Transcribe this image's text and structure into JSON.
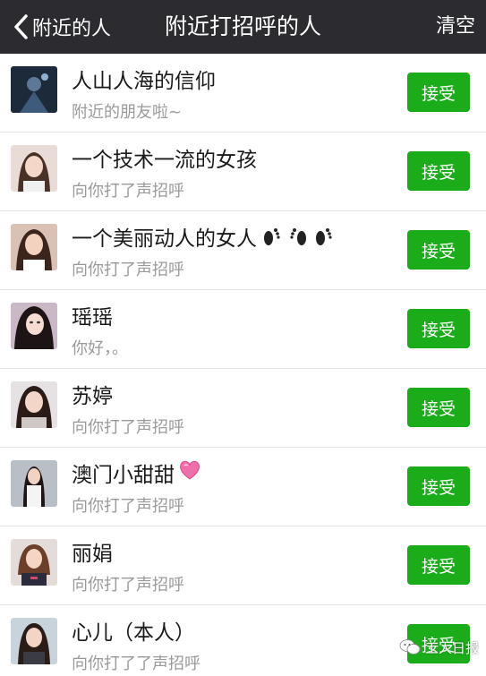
{
  "nav": {
    "back_label": "附近的人",
    "title": "附近打招呼的人",
    "clear_label": "清空"
  },
  "accept_label": "接受",
  "items": [
    {
      "name": "人山人海的信仰",
      "message": "附近的朋友啦~",
      "avatar": "avatar-dark-figure"
    },
    {
      "name": "一个技术一流的女孩",
      "message": "向你打了声招呼",
      "avatar": "avatar-girl-1"
    },
    {
      "name": "一个美丽动人的女人",
      "message": "向你打了声招呼",
      "avatar": "avatar-girl-2",
      "emoji": "footprints-icon"
    },
    {
      "name": "瑶瑶",
      "message": "你好，。",
      "avatar": "avatar-girl-3"
    },
    {
      "name": "苏婷",
      "message": "向你打了声招呼",
      "avatar": "avatar-girl-4"
    },
    {
      "name": "澳门小甜甜",
      "message": "向你打了声招呼",
      "avatar": "avatar-girl-5",
      "emoji": "pink-heart-icon"
    },
    {
      "name": "丽娟",
      "message": "向你打了声招呼",
      "avatar": "avatar-girl-6"
    },
    {
      "name": "心儿（本人）",
      "message": "向你打了了声招呼",
      "avatar": "avatar-girl-7"
    }
  ],
  "watermark": "工人日报",
  "colors": {
    "navbar": "#2b2b30",
    "accept_button": "#1aad19",
    "page_background": "#f0eff4"
  }
}
